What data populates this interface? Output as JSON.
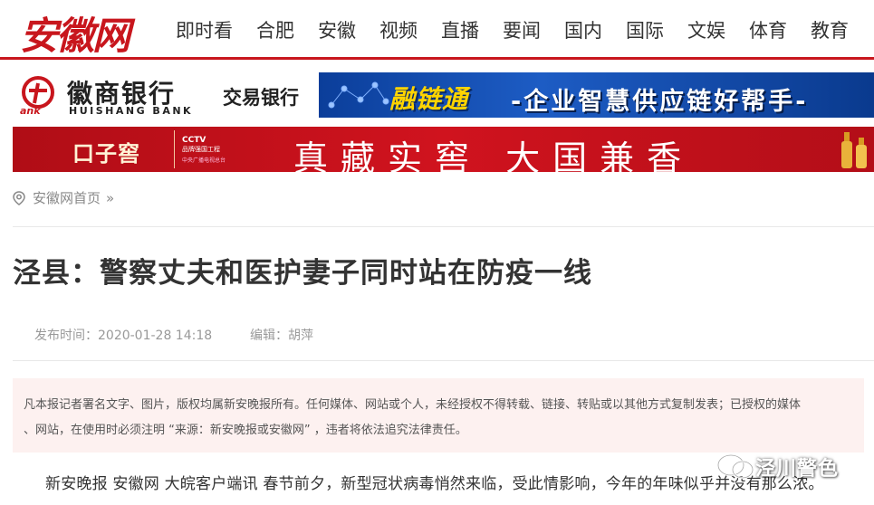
{
  "site": {
    "logo_text": "安徽网",
    "nav": [
      "即时看",
      "合肥",
      "安徽",
      "视频",
      "直播",
      "要闻",
      "国内",
      "国际",
      "文娱",
      "体育",
      "教育"
    ]
  },
  "ads": {
    "bank": {
      "name_cn": "徽商银行",
      "name_en": "HUISHANG BANK",
      "logo_letters": "ank",
      "slogan": "交易银行",
      "product": "融链通",
      "tagline": "-企业智慧供应链好帮手-"
    },
    "liquor": {
      "brand": "口子窖",
      "cctv_label": "CCTV",
      "cctv_sub": "品牌强国工程",
      "cctv_org": "中央广播电视总台",
      "slogan": "真藏实窖  大国兼香"
    }
  },
  "breadcrumb": {
    "home": "安徽网首页",
    "separator": "»"
  },
  "article": {
    "title": "泾县：警察丈夫和医护妻子同时站在防疫一线",
    "publish_time": "发布时间：2020-01-28 14:18",
    "editor": "编辑：胡萍",
    "notice_line1": "凡本报记者署名文字、图片，版权均属新安晚报所有。任何媒体、网站或个人，未经授权不得转载、链接、转贴或以其他方式复制发表；已授权的媒体",
    "notice_line2": "、网站，在使用时必须注明 “来源：新安晚报或安徽网” ，违者将依法追究法律责任。",
    "body_first_line": "新安晚报 安徽网 大皖客户端讯 春节前夕，新型冠状病毒悄然来临，受此情影响，今年的年味似乎并没有那么浓。"
  },
  "watermark": {
    "text": "泾川警色"
  },
  "colors": {
    "brand_red": "#c8161d",
    "notice_bg": "#fdf1f0",
    "bank_blue": "#0b3e9a",
    "bank_yellow": "#ffd400"
  }
}
